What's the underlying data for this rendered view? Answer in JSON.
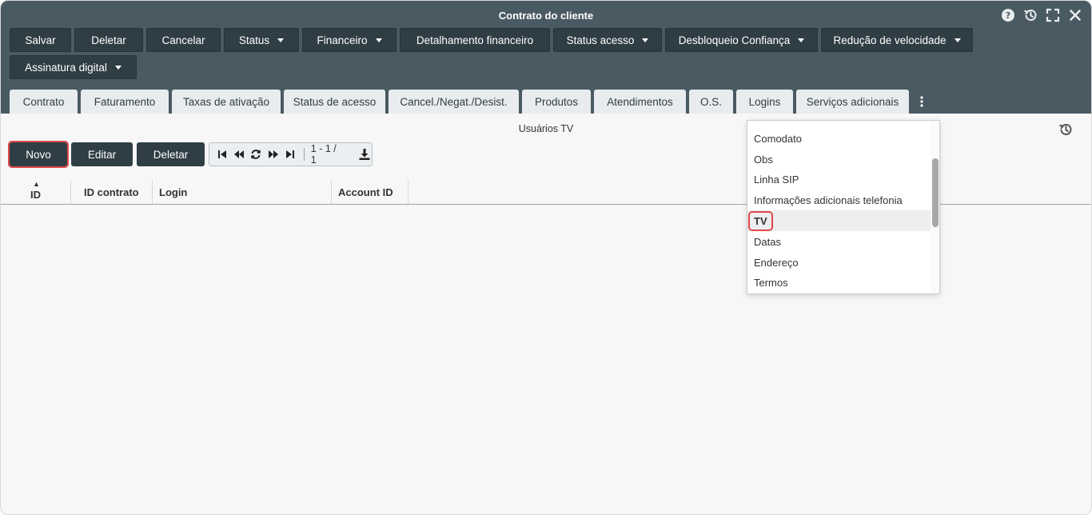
{
  "window": {
    "title": "Contrato do cliente",
    "controls": [
      "help-icon",
      "history-icon",
      "fullscreen-icon",
      "close-icon"
    ]
  },
  "toolbar": {
    "row1": [
      {
        "label": "Salvar",
        "dropdown": false
      },
      {
        "label": "Deletar",
        "dropdown": false
      },
      {
        "label": "Cancelar",
        "dropdown": false
      },
      {
        "label": "Status",
        "dropdown": true
      },
      {
        "label": "Financeiro",
        "dropdown": true
      },
      {
        "label": "Detalhamento financeiro",
        "dropdown": false
      },
      {
        "label": "Status acesso",
        "dropdown": true
      },
      {
        "label": "Desbloqueio Confiança",
        "dropdown": true
      },
      {
        "label": "Redução de velocidade",
        "dropdown": true
      }
    ],
    "row2": [
      {
        "label": "Assinatura digital",
        "dropdown": true
      }
    ]
  },
  "tabs": [
    "Contrato",
    "Faturamento",
    "Taxas de ativação",
    "Status de acesso",
    "Cancel./Negat./Desist.",
    "Produtos",
    "Atendimentos",
    "O.S.",
    "Logins",
    "Serviços adicionais"
  ],
  "panel": {
    "title": "Usuários TV",
    "buttons": {
      "new": "Novo",
      "edit": "Editar",
      "delete": "Deletar"
    },
    "pager": {
      "count": "1 - 1 / 1"
    }
  },
  "grid": {
    "columns": [
      "ID",
      "ID contrato",
      "Login",
      "Account ID"
    ],
    "sort_column": "ID",
    "sort_direction": "ascending"
  },
  "overflow_menu": {
    "items": [
      "Comodato",
      "Obs",
      "Linha SIP",
      "Informações adicionais telefonia",
      "TV",
      "Datas",
      "Endereço",
      "Termos"
    ],
    "selected": "TV"
  },
  "colors": {
    "header_bg": "#4a5a63",
    "button_bg": "#2f3e45",
    "highlight": "#e04848"
  }
}
